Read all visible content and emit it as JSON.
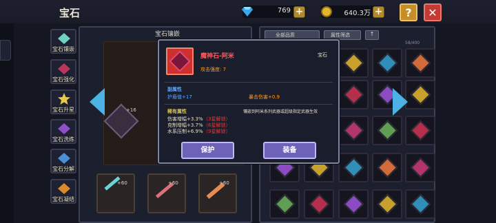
{
  "header": {
    "title": "宝石",
    "diamonds": "769",
    "gold": "640.3万",
    "help_label": "?",
    "close_label": "✕"
  },
  "sidebar": {
    "items": [
      {
        "label": "宝石镶嵌",
        "icon": "gem-inlay-icon"
      },
      {
        "label": "宝石强化",
        "icon": "gem-enhance-icon"
      },
      {
        "label": "宝石升星",
        "icon": "star-icon"
      },
      {
        "label": "宝石洗练",
        "icon": "gem-refine-icon"
      },
      {
        "label": "宝石分解",
        "icon": "gem-decompose-icon"
      },
      {
        "label": "宝石凝结",
        "icon": "gem-condense-icon"
      }
    ]
  },
  "inlay_panel": {
    "title": "宝石镶嵌",
    "level": "+16",
    "slots": [
      {
        "level": "+60"
      },
      {
        "level": "+60"
      },
      {
        "level": "+60"
      }
    ]
  },
  "bag": {
    "filter_all": "全部品质",
    "filter_attr": "属性筛选",
    "count": "58/400"
  },
  "popup": {
    "gem_name": "魔神石-阿米",
    "gem_type": "宝石",
    "attack_strength": "攻击强度: 7",
    "sub_attr_title": "副属性",
    "sub_attrs": [
      "护盾值+17",
      "暴击伤害+0.9"
    ],
    "rare_title": "稀有属性",
    "rare_note": "镶嵌到阿米系列武器或超级指定武器生效",
    "rare_attrs": [
      {
        "text": "伤害增幅+3.3%",
        "unlock": "（3星解锁）"
      },
      {
        "text": "克制增幅+3.7%",
        "unlock": "（6星解锁）"
      },
      {
        "text": "水系压制+6.9%",
        "unlock": "（9星解锁）"
      }
    ],
    "protect_label": "保护",
    "equip_label": "装备"
  },
  "colors": {
    "accent_purple": "#6c62b8",
    "gem_red": "#c4264c",
    "label_blue": "#5ea5ff",
    "label_orange": "#ff9e2a",
    "unlock_red": "#e63a3a",
    "rare_gold": "#d9c75c"
  }
}
